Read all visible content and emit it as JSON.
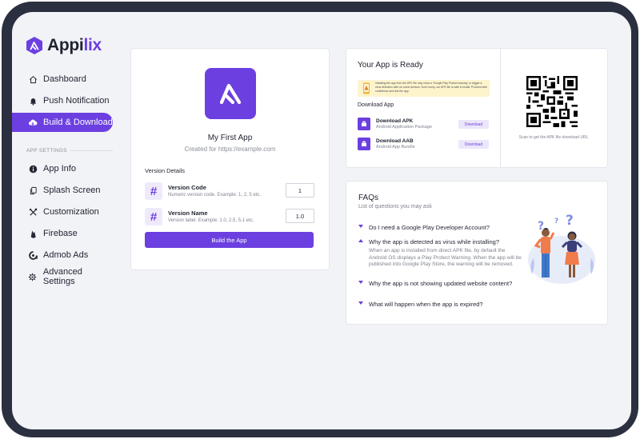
{
  "brand": {
    "name_part1": "Appi",
    "name_part2": "lix",
    "accent": "#6c3fe0"
  },
  "sidebar": {
    "items": [
      {
        "label": "Dashboard",
        "icon": "home-icon"
      },
      {
        "label": "Push Notification",
        "icon": "bell-icon"
      },
      {
        "label": "Build & Download",
        "icon": "cloud-download-icon",
        "active": true
      }
    ],
    "section_label": "APP SETTINGS",
    "settings_items": [
      {
        "label": "App Info",
        "icon": "info-icon"
      },
      {
        "label": "Splash Screen",
        "icon": "copy-icon"
      },
      {
        "label": "Customization",
        "icon": "tools-icon"
      },
      {
        "label": "Firebase",
        "icon": "firebase-icon"
      },
      {
        "label": "Admob Ads",
        "icon": "admob-icon"
      },
      {
        "label": "Advanced Settings",
        "icon": "gear-icon"
      }
    ]
  },
  "app": {
    "name": "My First App",
    "created_for": "Created for https://example.com",
    "version_details_title": "Version Details",
    "version_code_label": "Version Code",
    "version_code_hint": "Numeric version code. Example: 1, 2, 5 etc.",
    "version_code_value": "1",
    "version_name_label": "Version Name",
    "version_name_hint": "Version label. Example: 1.0, 2.5, 5.1 etc.",
    "version_name_value": "1.0",
    "build_button": "Build the App"
  },
  "ready": {
    "title": "Your App is Ready",
    "warning": "Installing the app from the APK file may show a 'Google Play Protect warning' or trigger a virus detection alert on some devices. Don't worry, our APK file is safe to install. Proceed with confidence and test the app.",
    "download_title": "Download App",
    "downloads": [
      {
        "name": "Download APK",
        "sub": "Android Application Package",
        "button": "Download"
      },
      {
        "name": "Download AAB",
        "sub": "Android App Bundle",
        "button": "Download"
      }
    ],
    "qr_caption": "Scan to get the APK file download URL"
  },
  "faq": {
    "title": "FAQs",
    "subtitle": "List of questions you may ask",
    "items": [
      {
        "q": "Do I need a Google Play Developer Account?",
        "open": false
      },
      {
        "q": "Why the app is detected as virus while installing?",
        "open": true,
        "a": "When an app is installed from direct APK file, by default the Android OS displays a Play Protect Warning. When the app will be published into Google Play Store, the warning will be removed."
      },
      {
        "q": "Why the app is not showing updated website content?",
        "open": false
      },
      {
        "q": "What will happen when the app is expired?",
        "open": false
      }
    ]
  }
}
